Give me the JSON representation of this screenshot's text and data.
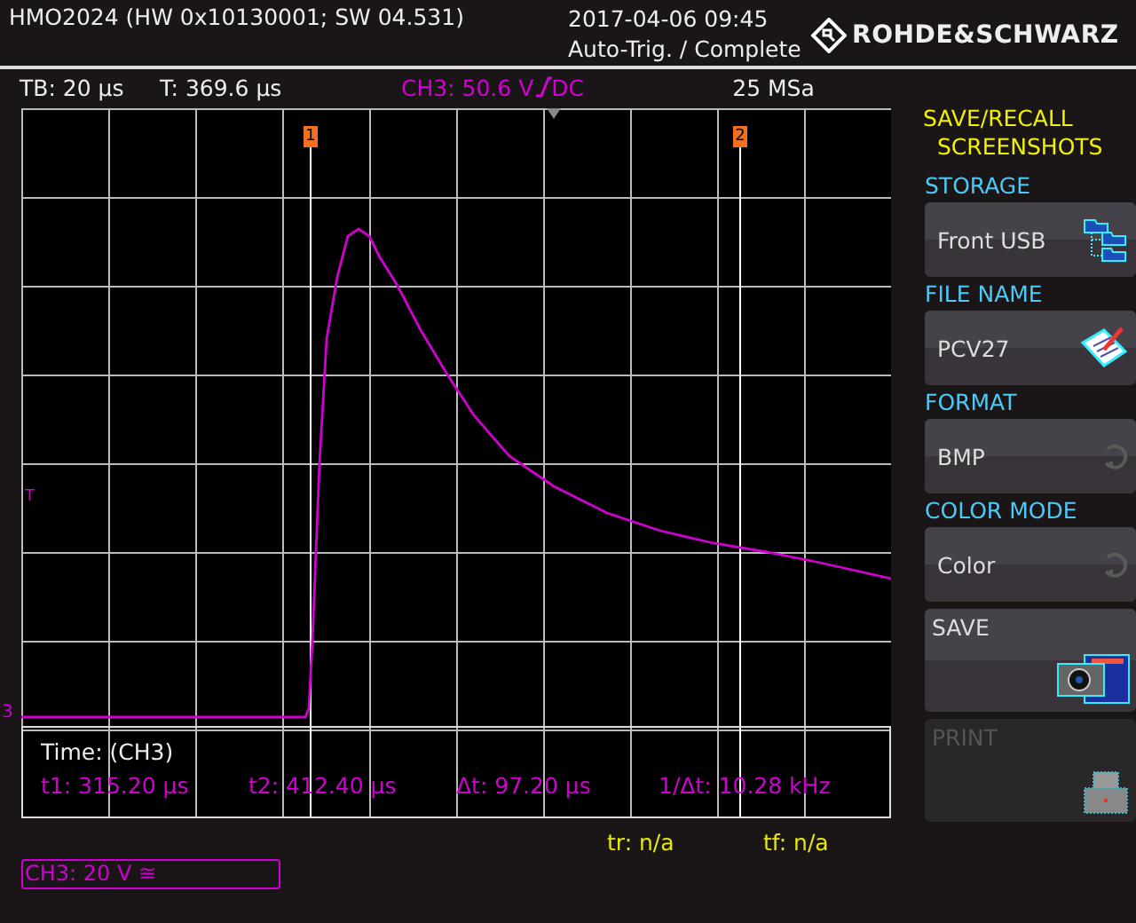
{
  "header": {
    "title": "HMO2024 (HW 0x10130001; SW 04.531)",
    "datetime": "2017-04-06 09:45",
    "status": "Auto-Trig. / Complete",
    "brand": "ROHDE&SCHWARZ"
  },
  "info_bar": {
    "timebase": "TB: 20 µs",
    "trigger_time": "T: 369.6 µs",
    "trigger_level": "CH3: 50.6 V",
    "trigger_coupling": "DC",
    "sample_rate": "25 MSa"
  },
  "screen": {
    "cursors": [
      {
        "label": "1"
      },
      {
        "label": "2"
      }
    ],
    "trigger_marker": "T",
    "channel_marker": "3",
    "measurement": {
      "title": "Time: (CH3)",
      "values": [
        "t1: 315.20 µs",
        "t2: 412.40 µs",
        "Δt: 97.20 µs",
        "1/Δt: 10.28 kHz"
      ]
    }
  },
  "rise_fall": [
    "tr: n/a",
    "tf: n/a"
  ],
  "channel_label": "CH3: 20 V ≅",
  "menu": {
    "title": "SAVE/RECALL",
    "subtitle": "SCREENSHOTS",
    "settings": [
      {
        "heading": "STORAGE",
        "value": "Front USB",
        "kind": "folders"
      },
      {
        "heading": "FILE NAME",
        "value": "PCV27",
        "kind": "notepad"
      },
      {
        "heading": "FORMAT",
        "value": "BMP",
        "kind": "cycle"
      },
      {
        "heading": "COLOR MODE",
        "value": "Color",
        "kind": "cycle"
      }
    ],
    "actions": [
      {
        "label": "SAVE",
        "kind": "camera",
        "disabled": false
      },
      {
        "label": "PRINT",
        "kind": "printer",
        "disabled": true
      }
    ]
  }
}
